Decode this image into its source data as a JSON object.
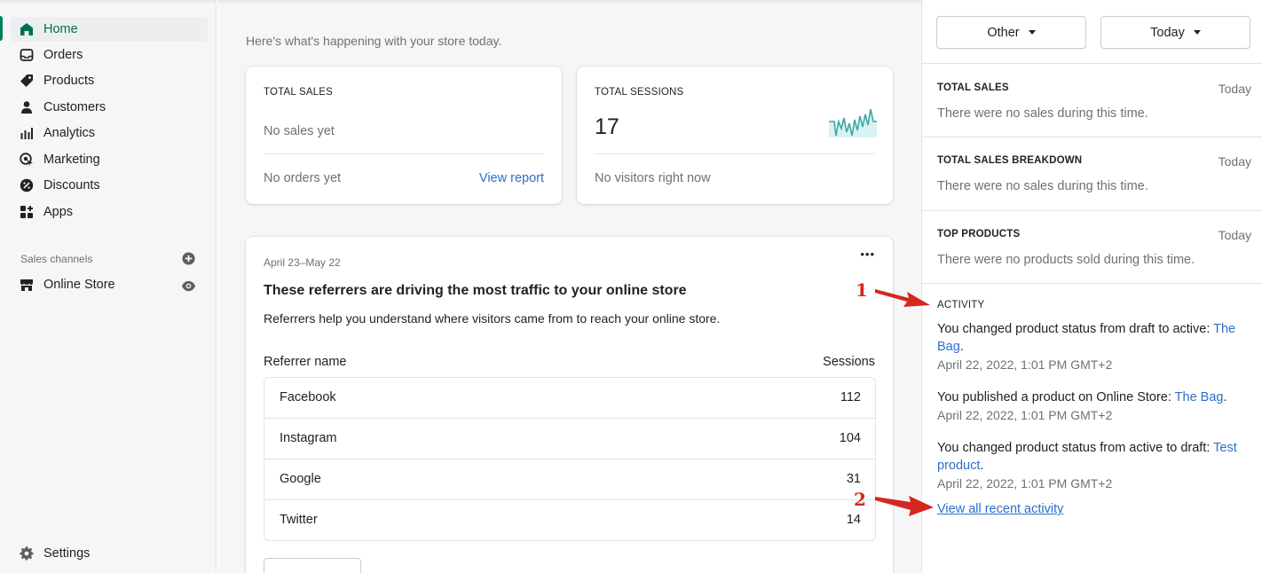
{
  "sidebar": {
    "items": [
      {
        "label": "Home",
        "icon": "home-icon",
        "active": true
      },
      {
        "label": "Orders",
        "icon": "inbox-icon"
      },
      {
        "label": "Products",
        "icon": "tag-icon"
      },
      {
        "label": "Customers",
        "icon": "person-icon"
      },
      {
        "label": "Analytics",
        "icon": "bar-chart-icon"
      },
      {
        "label": "Marketing",
        "icon": "target-icon"
      },
      {
        "label": "Discounts",
        "icon": "discount-icon"
      },
      {
        "label": "Apps",
        "icon": "apps-icon"
      }
    ],
    "sales_channels_label": "Sales channels",
    "online_store_label": "Online Store",
    "settings_label": "Settings",
    "accent": "#008060"
  },
  "main": {
    "greeting": "Here's what's happening with your store today.",
    "total_sales": {
      "label": "TOTAL SALES",
      "status": "No sales yet",
      "orders": "No orders yet",
      "link": "View report"
    },
    "total_sessions": {
      "label": "TOTAL SESSIONS",
      "value": "17",
      "visitors": "No visitors right now",
      "sparkline_color": "#47c1bf"
    },
    "referrers": {
      "date_range": "April 23–May 22",
      "more_label": "•••",
      "title": "These referrers are driving the most traffic to your online store",
      "description": "Referrers help you understand where visitors came from to reach your online store.",
      "col_name": "Referrer name",
      "col_sessions": "Sessions",
      "rows": [
        {
          "name": "Facebook",
          "sessions": "112"
        },
        {
          "name": "Instagram",
          "sessions": "104"
        },
        {
          "name": "Google",
          "sessions": "31"
        },
        {
          "name": "Twitter",
          "sessions": "14"
        }
      ]
    }
  },
  "right": {
    "filters": {
      "channel": "Other",
      "period": "Today"
    },
    "sections": [
      {
        "title": "TOTAL SALES",
        "when": "Today",
        "text": "There were no sales during this time."
      },
      {
        "title": "TOTAL SALES BREAKDOWN",
        "when": "Today",
        "text": "There were no sales during this time."
      },
      {
        "title": "TOP PRODUCTS",
        "when": "Today",
        "text": "There were no products sold during this time."
      }
    ],
    "activity": {
      "title": "ACTIVITY",
      "items": [
        {
          "text": "You changed product status from draft to active: ",
          "link": "The Bag",
          "end": ".",
          "time": "April 22, 2022, 1:01 PM GMT+2"
        },
        {
          "text": "You published a product on Online Store: ",
          "link": "The Bag",
          "end": ".",
          "time": "April 22, 2022, 1:01 PM GMT+2"
        },
        {
          "text": "You changed product status from active to draft: ",
          "link": "Test product",
          "end": ".",
          "time": "April 22, 2022, 1:01 PM GMT+2"
        }
      ],
      "view_all": "View all recent activity"
    }
  },
  "annotations": [
    {
      "number": "1"
    },
    {
      "number": "2"
    }
  ],
  "colors": {
    "annotation": "#d6261f",
    "link": "#2c6ecb"
  }
}
